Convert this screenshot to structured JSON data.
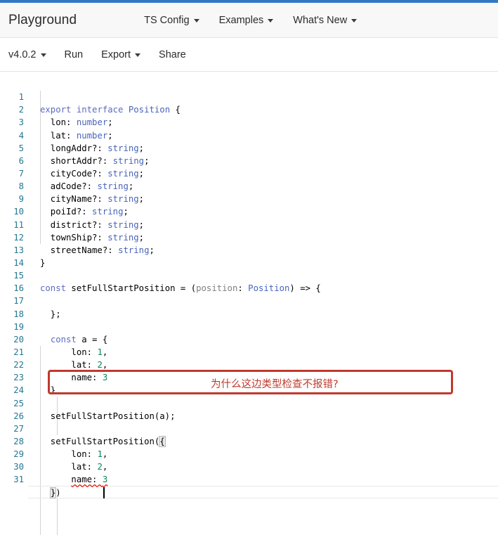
{
  "theme": {
    "accent_bar": "#3178c6",
    "header_bg": "#f8f8f8",
    "annotation_red": "#c0392b",
    "linenumber_blue": "#237893",
    "keyword_blue": "#0000ff",
    "type_teal": "#267f99",
    "number_green": "#098658",
    "error_red": "#e51400"
  },
  "header": {
    "brand": "Playground",
    "nav": [
      {
        "label": "TS Config",
        "has_caret": true
      },
      {
        "label": "Examples",
        "has_caret": true
      },
      {
        "label": "What's New",
        "has_caret": true
      }
    ]
  },
  "toolbar": {
    "items": [
      {
        "label": "v4.0.2",
        "has_caret": true
      },
      {
        "label": "Run",
        "has_caret": false
      },
      {
        "label": "Export",
        "has_caret": true
      },
      {
        "label": "Share",
        "has_caret": false
      }
    ]
  },
  "editor": {
    "active_line": 28,
    "cursor_line": 28,
    "first_line": 1,
    "last_line": 31,
    "lines": [
      {
        "n": 1,
        "text": "export interface Position {"
      },
      {
        "n": 2,
        "text": "  lon: number;"
      },
      {
        "n": 3,
        "text": "  lat: number;"
      },
      {
        "n": 4,
        "text": "  longAddr?: string;"
      },
      {
        "n": 5,
        "text": "  shortAddr?: string;"
      },
      {
        "n": 6,
        "text": "  cityCode?: string;"
      },
      {
        "n": 7,
        "text": "  adCode?: string;"
      },
      {
        "n": 8,
        "text": "  cityName?: string;"
      },
      {
        "n": 9,
        "text": "  poiId?: string;"
      },
      {
        "n": 10,
        "text": "  district?: string;"
      },
      {
        "n": 11,
        "text": "  townShip?: string;"
      },
      {
        "n": 12,
        "text": "  streetName?: string;"
      },
      {
        "n": 13,
        "text": "}"
      },
      {
        "n": 14,
        "text": ""
      },
      {
        "n": 15,
        "text": "const setFullStartPosition = (position: Position) => {"
      },
      {
        "n": 16,
        "text": ""
      },
      {
        "n": 17,
        "text": "  };"
      },
      {
        "n": 18,
        "text": ""
      },
      {
        "n": 19,
        "text": "  const a = {"
      },
      {
        "n": 20,
        "text": "      lon: 1,"
      },
      {
        "n": 21,
        "text": "      lat: 2,"
      },
      {
        "n": 22,
        "text": "      name: 3"
      },
      {
        "n": 23,
        "text": "  }"
      },
      {
        "n": 24,
        "text": ""
      },
      {
        "n": 25,
        "text": "  setFullStartPosition(a);"
      },
      {
        "n": 26,
        "text": ""
      },
      {
        "n": 27,
        "text": "  setFullStartPosition({"
      },
      {
        "n": 28,
        "text": "      lon: 1,"
      },
      {
        "n": 29,
        "text": "      lat: 2,"
      },
      {
        "n": 30,
        "text": "      name: 3"
      },
      {
        "n": 31,
        "text": "  })"
      }
    ],
    "error_marker": {
      "line": 30,
      "token": "name: 3",
      "kind": "red-squiggle"
    },
    "bracket_matches": [
      {
        "line": 27,
        "token": "{"
      },
      {
        "line": 31,
        "token": "}"
      }
    ]
  },
  "annotation": {
    "text": "为什么这边类型检查不报错?",
    "highlighted_line": 25,
    "highlighted_code": "setFullStartPosition(a);"
  }
}
